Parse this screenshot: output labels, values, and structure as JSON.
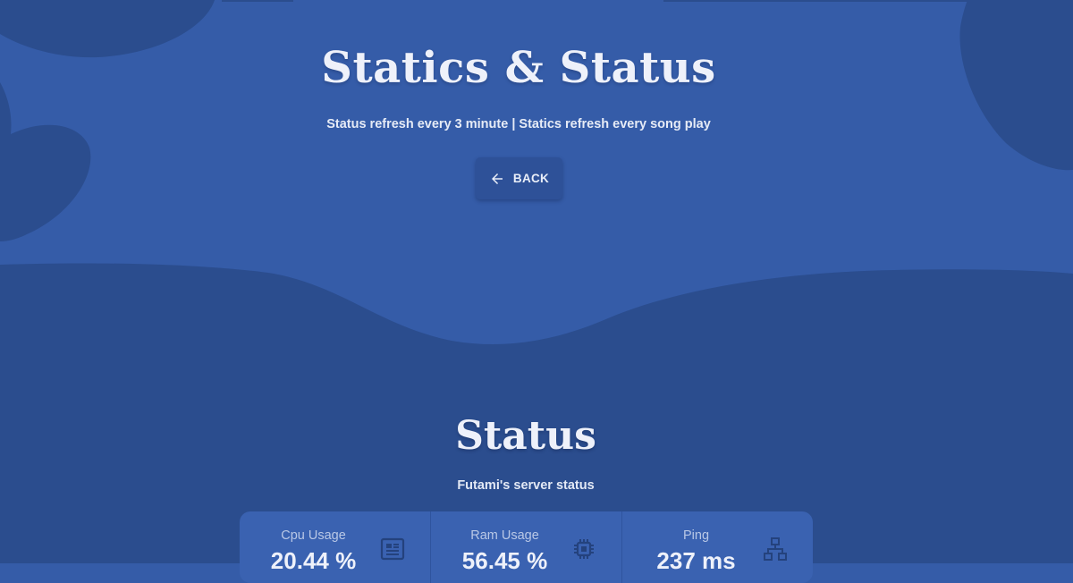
{
  "hero": {
    "title": "Statics & Status",
    "subtitle": "Status refresh every 3 minute | Statics refresh every song play",
    "back_label": "BACK",
    "back_icon": "arrow-left-icon"
  },
  "status": {
    "title": "Status",
    "subtitle": "Futami's server status",
    "stats": [
      {
        "label": "Cpu Usage",
        "value": "20.44 %",
        "icon": "cpu-icon"
      },
      {
        "label": "Ram Usage",
        "value": "56.45 %",
        "icon": "memory-chip-icon"
      },
      {
        "label": "Ping",
        "value": "237 ms",
        "icon": "network-icon"
      }
    ]
  },
  "colors": {
    "background": "#355ca8",
    "dark_blob": "#2b4d8e",
    "card": "#3a62b1",
    "button": "#2e5198",
    "text": "#eef1fa",
    "icon": "#24427d"
  }
}
